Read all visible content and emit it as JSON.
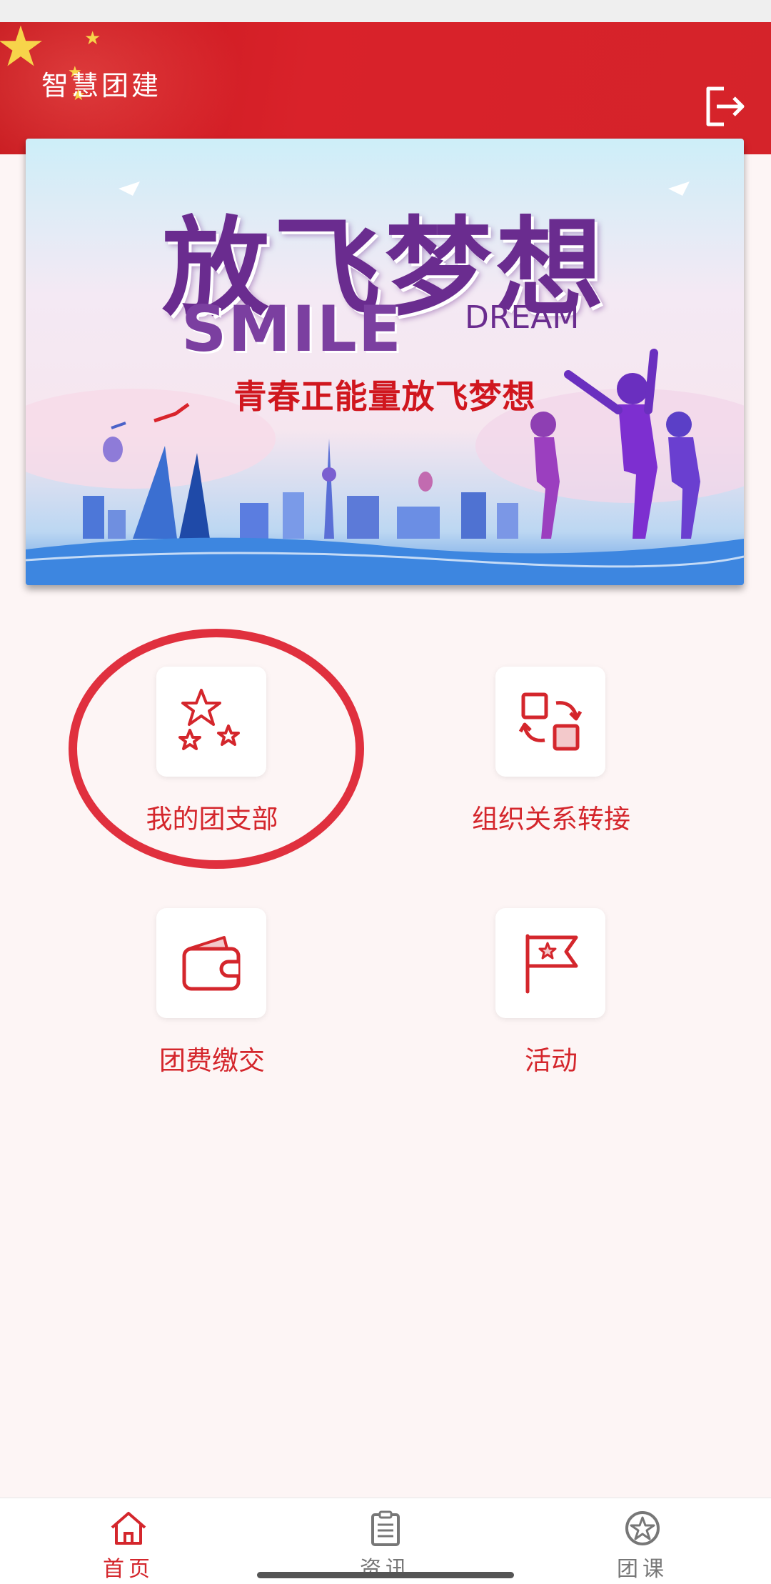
{
  "header": {
    "title": "智慧团建",
    "logout_icon": "logout-icon"
  },
  "banner": {
    "headline": "放飞梦想",
    "english_1": "SMILE",
    "english_2": "DREAM",
    "slogan": "青春正能量放飞梦想"
  },
  "menu": {
    "items": [
      {
        "label": "我的团支部",
        "icon": "stars-icon",
        "highlighted": true
      },
      {
        "label": "组织关系转接",
        "icon": "transfer-icon",
        "highlighted": false
      },
      {
        "label": "团费缴交",
        "icon": "wallet-icon",
        "highlighted": false
      },
      {
        "label": "活动",
        "icon": "flag-icon",
        "highlighted": false
      }
    ]
  },
  "tabbar": {
    "tabs": [
      {
        "label": "首页",
        "icon": "home-icon",
        "active": true
      },
      {
        "label": "资讯",
        "icon": "news-icon",
        "active": false
      },
      {
        "label": "团课",
        "icon": "star-badge-icon",
        "active": false
      }
    ]
  },
  "colors": {
    "accent": "#d4262c",
    "header_red": "#d9222a",
    "highlight_ring": "#e0303e",
    "inactive": "#777777"
  }
}
